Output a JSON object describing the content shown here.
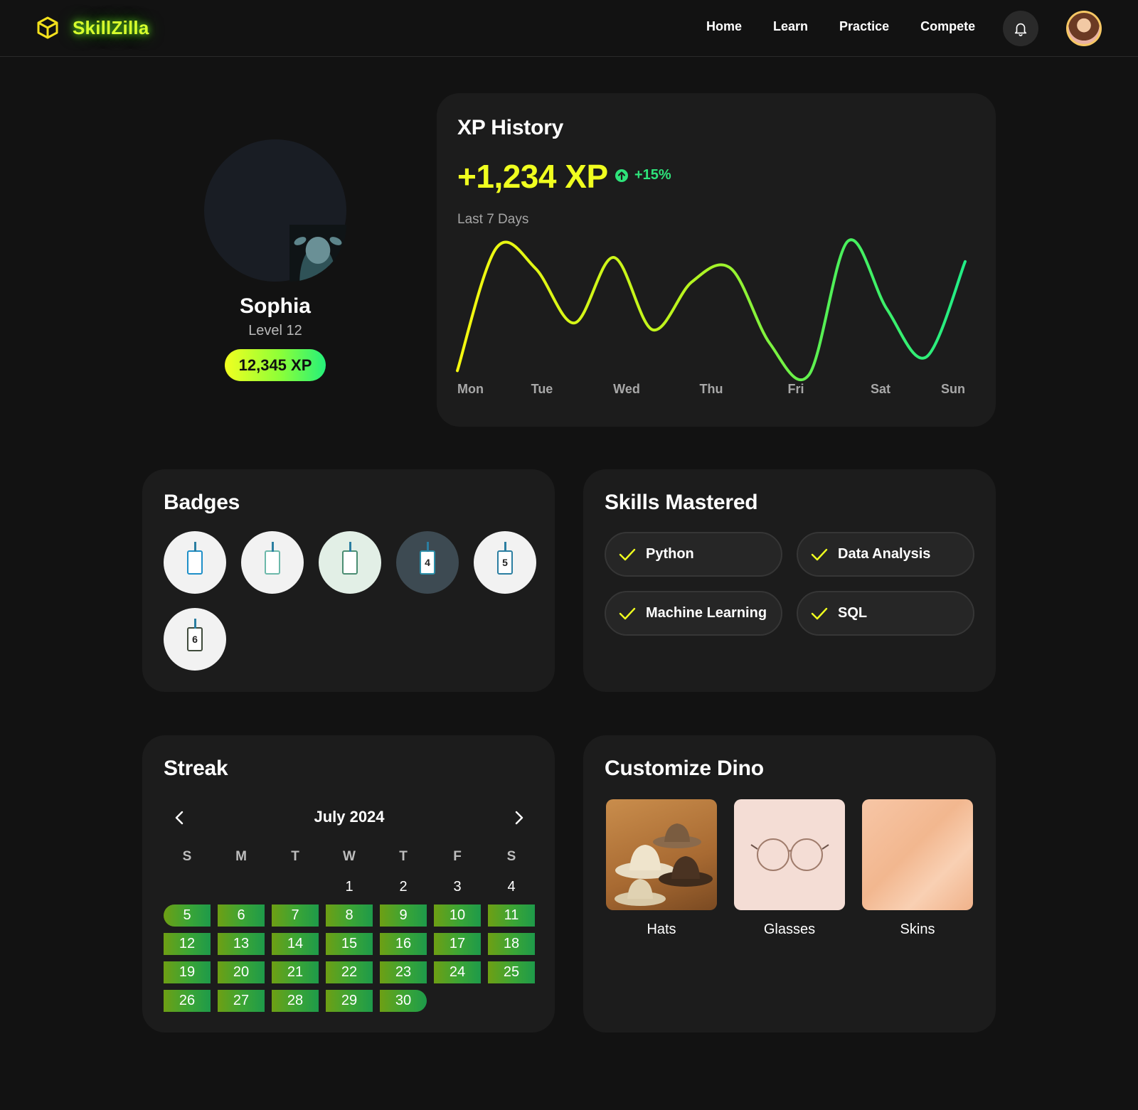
{
  "header": {
    "brand": "SkillZilla",
    "nav": [
      "Home",
      "Learn",
      "Practice",
      "Compete"
    ]
  },
  "profile": {
    "name": "Sophia",
    "level": "Level 12",
    "xp": "12,345 XP"
  },
  "xp_history": {
    "title": "XP History",
    "total": "+1,234 XP",
    "delta": "+15%",
    "period": "Last 7 Days"
  },
  "chart_data": {
    "type": "line",
    "categories": [
      "Mon",
      "Tue",
      "Wed",
      "Thu",
      "Fri",
      "Sat",
      "Sun"
    ],
    "y": [
      0.05,
      0.95,
      0.8,
      0.4,
      0.88,
      0.35,
      0.7,
      0.8,
      0.25,
      0.02,
      1.0,
      0.5,
      0.15,
      0.85
    ],
    "title": "",
    "xlabel": "",
    "ylabel": "",
    "grid": false
  },
  "badges": {
    "title": "Badges",
    "items": [
      {
        "label": "",
        "bg": "#f2f2f2",
        "accent": "#1e8fc8"
      },
      {
        "label": "",
        "bg": "#f2f2f2",
        "accent": "#6cb8aa"
      },
      {
        "label": "",
        "bg": "#e2efe6",
        "accent": "#4a8d72"
      },
      {
        "label": "4",
        "bg": "#3d4a52",
        "accent": "#2a8ea8"
      },
      {
        "label": "5",
        "bg": "#f2f2f2",
        "accent": "#2b7ea1"
      },
      {
        "label": "6",
        "bg": "#f2f2f2",
        "accent": "#3f4a3b"
      }
    ]
  },
  "skills": {
    "title": "Skills Mastered",
    "items": [
      "Python",
      "Data Analysis",
      "Machine Learning",
      "SQL"
    ]
  },
  "streak": {
    "title": "Streak",
    "month": "July 2024",
    "weekdays": [
      "S",
      "M",
      "T",
      "W",
      "T",
      "F",
      "S"
    ],
    "days": [
      "1",
      "2",
      "3",
      "4",
      "5",
      "6",
      "7",
      "8",
      "9",
      "10",
      "11",
      "12",
      "13",
      "14",
      "15",
      "16",
      "17",
      "18",
      "19",
      "20",
      "21",
      "22",
      "23",
      "24",
      "25",
      "26",
      "27",
      "28",
      "29",
      "30"
    ]
  },
  "customize": {
    "title": "Customize Dino",
    "items": [
      "Hats",
      "Glasses",
      "Skins"
    ]
  },
  "colors": {
    "accent_yellow": "#f0ff1f",
    "accent_green": "#2ee37a",
    "card_bg": "#1c1c1c",
    "page_bg": "#121212"
  }
}
